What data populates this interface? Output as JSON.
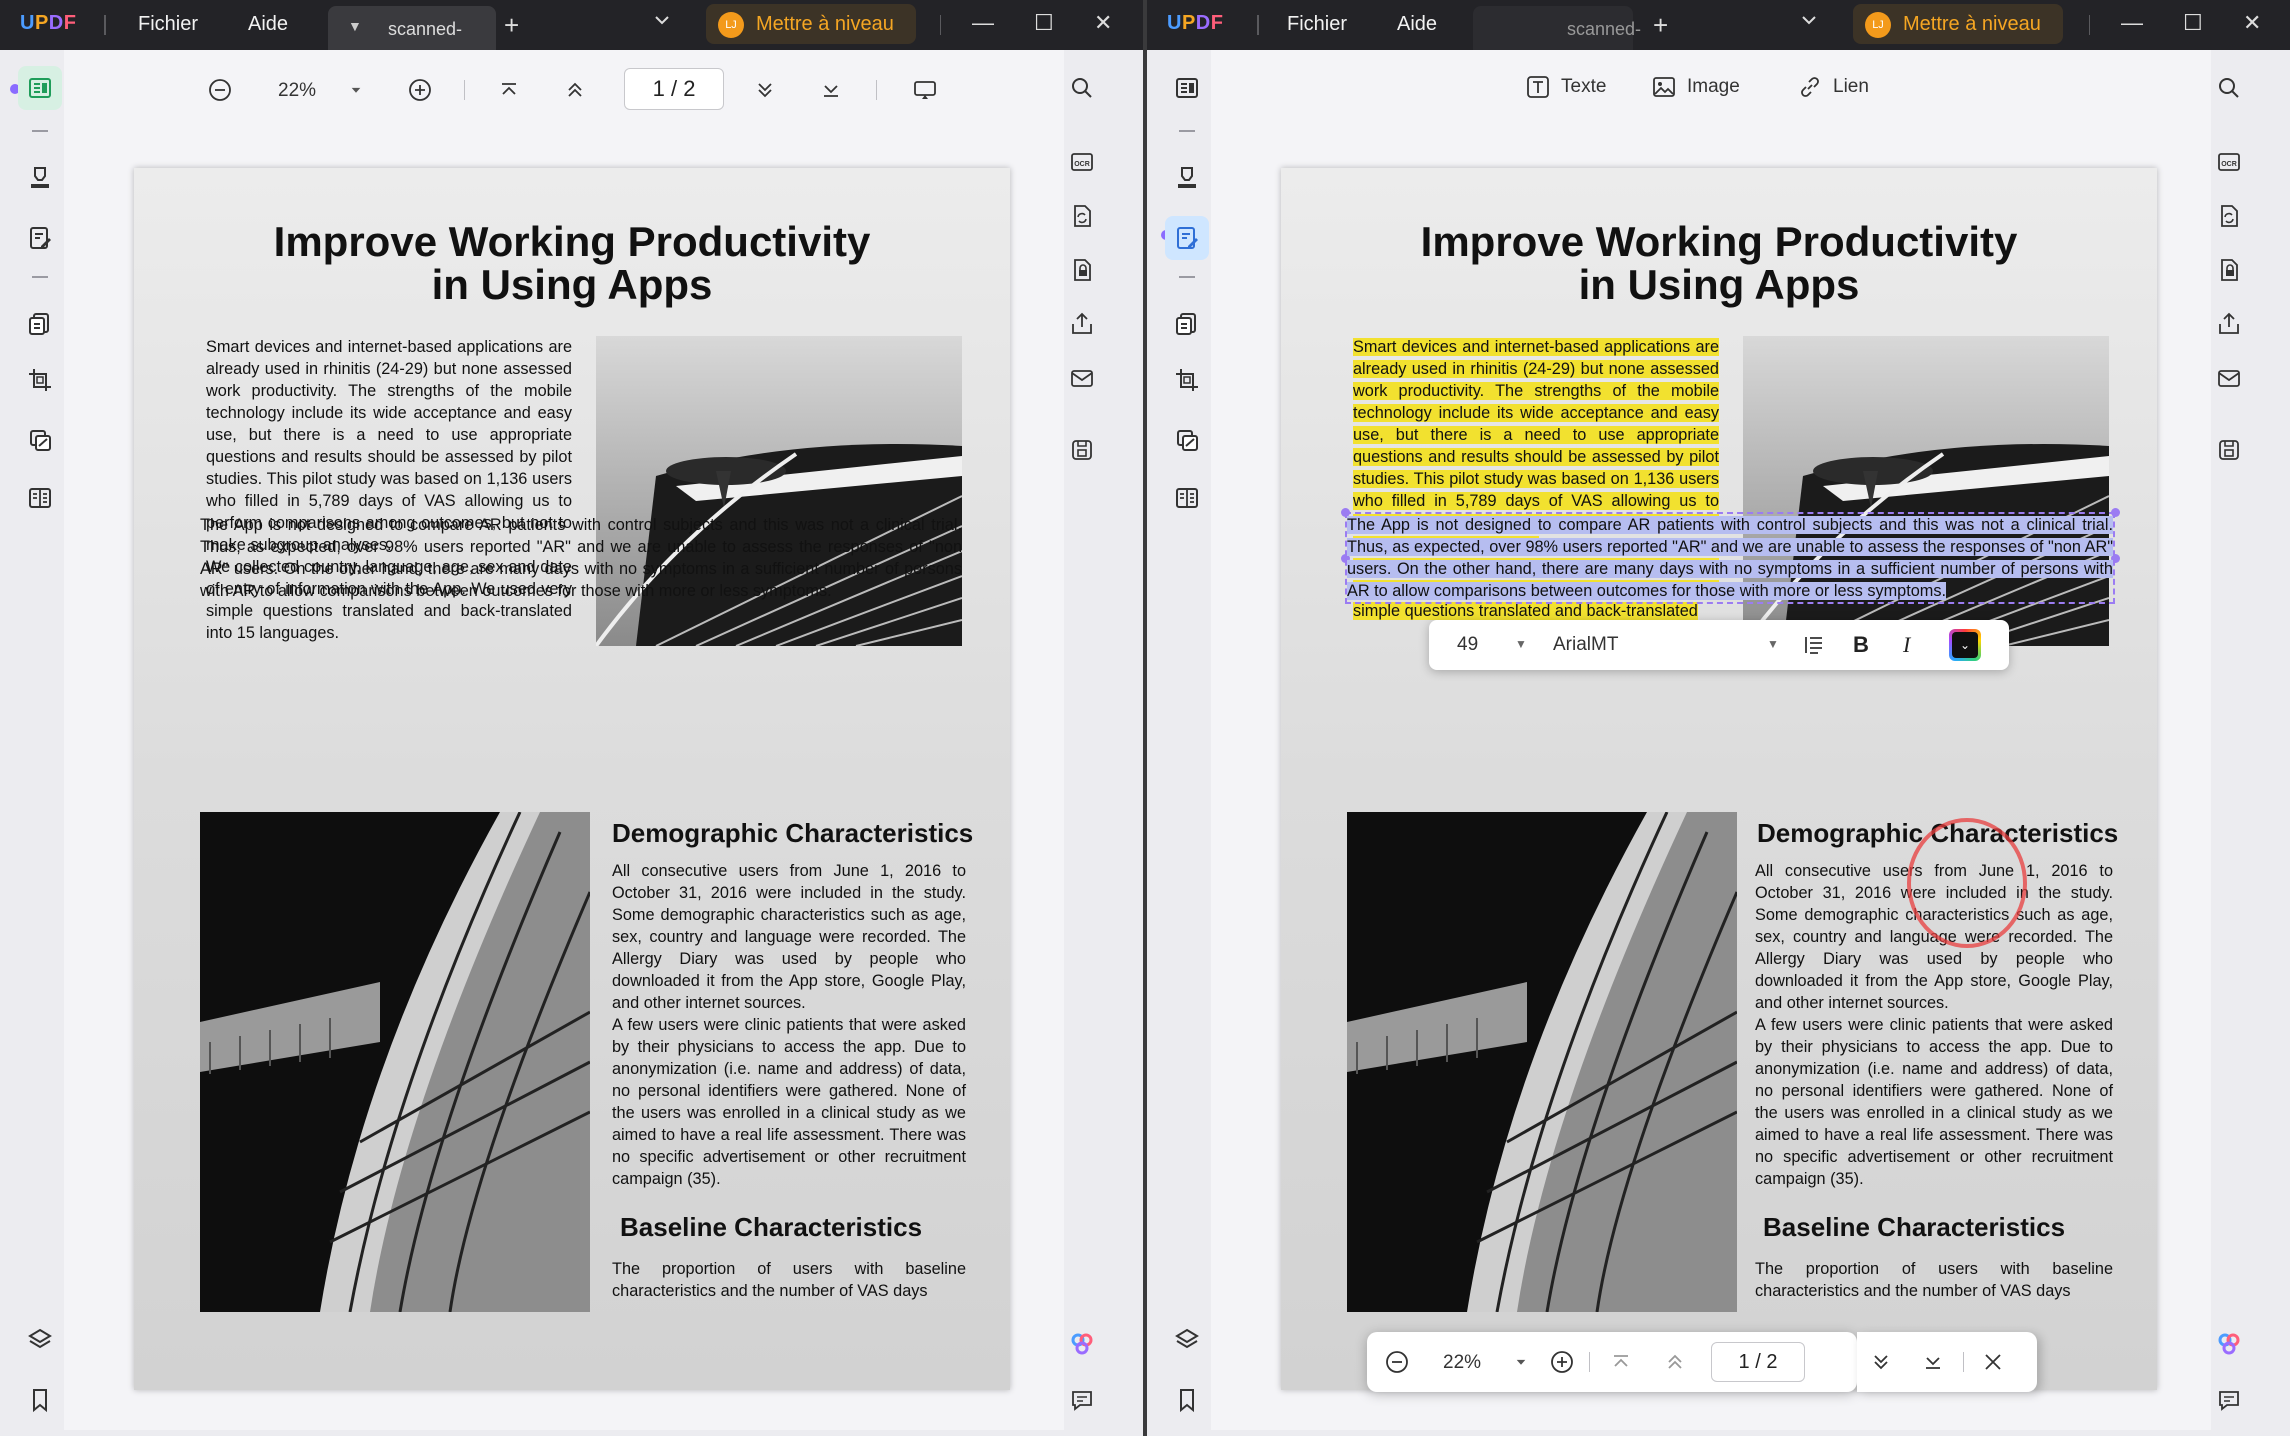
{
  "app": {
    "logo": "UPDF"
  },
  "titlebar": {
    "menu_file": "Fichier",
    "menu_help": "Aide",
    "tab_label": "scanned-",
    "new_tab": "+",
    "tabs_dropdown": "⌄",
    "upgrade_label": "Mettre à niveau",
    "avatar_initials": "LJ",
    "minimize": "—",
    "maximize": "☐",
    "close": "✕"
  },
  "viewer_toolbar": {
    "zoom": "22%",
    "page_current": "1",
    "page_sep": "/",
    "page_total": "2"
  },
  "edit_toolbar": {
    "text_label": "Texte",
    "image_label": "Image",
    "link_label": "Lien"
  },
  "format_bar": {
    "font_size": "49",
    "font_name": "ArialMT",
    "bold": "B",
    "italic": "I"
  },
  "document": {
    "title_line1": "Improve Working Productivity",
    "title_line2": "in Using Apps",
    "para1": "Smart devices and internet-based applications are already used in rhinitis (24-29) but none assessed work productivity. The strengths of the mobile technology include its wide acceptance and easy use, but there is a need to use appropriate questions and results should be assessed by pilot studies. This pilot study was based on 1,136 users who filled in 5,789 days of VAS allowing us to perform comparisons among outcomes, but not to make subgroup analyses.",
    "para2": "We collected country, language, age, sex and date of entry of information with the App. We used very simple questions translated and back-translated into 15 languages.",
    "para2_right_visible": "We collected country, language, age, sex and date of entry of information with the App. We used very simple questions translated and back-translated",
    "para3": "The App is not designed to compare AR patients with control subjects and this was not a clinical trial. Thus, as expected, over 98% users reported \"AR\" and we are unable to assess the responses of \"non AR\" users. On the other hand, there are many days with no symptoms in a sufficient number of persons with AR to allow comparisons between outcomes for those with more or less symptoms.",
    "heading_demographic": "Demographic Characteristics",
    "para4": "All consecutive users from June 1, 2016 to October 31, 2016 were included in the study. Some demographic characteristics such as age, sex, country and language were recorded. The Allergy Diary was used by people who downloaded it from the App store, Google Play, and other internet sources.",
    "para5": "A few users were clinic patients that were asked by their physicians to access the app. Due to anonymization (i.e. name and address) of data, no personal identifiers were gathered. None of the users was enrolled in a clinical study as we aimed to have a real life assessment. There was no specific advertisement or other recruitment campaign (35).",
    "heading_baseline": "Baseline Characteristics",
    "para6": "The proportion of users with baseline characteristics and the number of VAS days"
  },
  "colors": {
    "accent_upgrade": "#f5a623",
    "highlight": "#f2e12f",
    "selection": "#b6bdf0"
  }
}
